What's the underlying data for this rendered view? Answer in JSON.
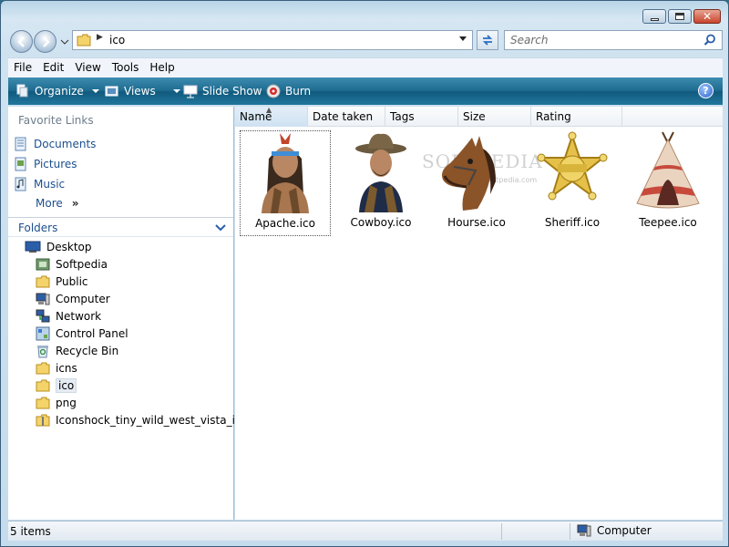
{
  "window": {
    "caption_buttons": [
      "minimize",
      "maximize",
      "close"
    ]
  },
  "address": {
    "path": "ico",
    "search_placeholder": "Search"
  },
  "menu": [
    "File",
    "Edit",
    "View",
    "Tools",
    "Help"
  ],
  "commands": {
    "organize": "Organize",
    "views": "Views",
    "slideshow": "Slide Show",
    "burn": "Burn",
    "help": "?"
  },
  "favorites": {
    "title": "Favorite Links",
    "items": [
      "Documents",
      "Pictures",
      "Music"
    ],
    "more": "More"
  },
  "folders": {
    "title": "Folders",
    "root": "Desktop",
    "items": [
      {
        "label": "Softpedia",
        "icon": "softpedia-folder-icon"
      },
      {
        "label": "Public",
        "icon": "folder-icon"
      },
      {
        "label": "Computer",
        "icon": "computer-icon"
      },
      {
        "label": "Network",
        "icon": "network-icon"
      },
      {
        "label": "Control Panel",
        "icon": "control-panel-icon"
      },
      {
        "label": "Recycle Bin",
        "icon": "recycle-bin-icon"
      },
      {
        "label": "icns",
        "icon": "folder-icon"
      },
      {
        "label": "ico",
        "icon": "folder-icon",
        "selected": true
      },
      {
        "label": "png",
        "icon": "folder-icon"
      },
      {
        "label": "Iconshock_tiny_wild_west_vista_icon",
        "icon": "zip-folder-icon"
      }
    ]
  },
  "columns": [
    "Name",
    "Date taken",
    "Tags",
    "Size",
    "Rating"
  ],
  "files": [
    {
      "name": "Apache.ico",
      "icon": "apache-icon"
    },
    {
      "name": "Cowboy.ico",
      "icon": "cowboy-icon"
    },
    {
      "name": "Hourse.ico",
      "icon": "horse-icon"
    },
    {
      "name": "Sheriff.ico",
      "icon": "sheriff-badge-icon"
    },
    {
      "name": "Teepee.ico",
      "icon": "teepee-icon"
    }
  ],
  "watermark": {
    "text": "SOFTPEDIA",
    "sub": "www.softpedia.com"
  },
  "status": {
    "count": "5 items",
    "location": "Computer"
  },
  "colors": {
    "command_bar": "#1e6b90",
    "link": "#1c4f8f"
  }
}
